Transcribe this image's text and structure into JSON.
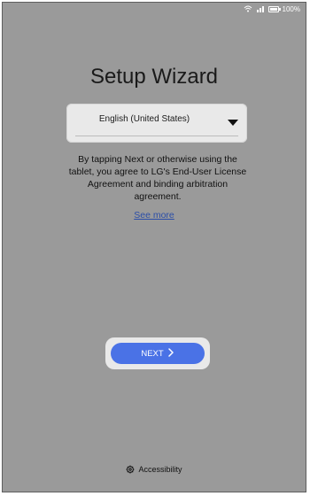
{
  "status_bar": {
    "battery_text": "100%",
    "battery_level": 1.0
  },
  "setup": {
    "title": "Setup Wizard",
    "language": {
      "selected": "English (United States)"
    },
    "agreement_text": "By tapping Next or otherwise using the tablet, you agree to LG's End-User License Agreement and binding arbitration agreement.",
    "see_more": "See more",
    "next_label": "NEXT"
  },
  "footer": {
    "accessibility_label": "Accessibility"
  },
  "icons": [
    "battery-icon",
    "wifi-icon",
    "signal-icon",
    "dropdown-caret-icon",
    "chevron-right-icon",
    "gear-icon"
  ],
  "colors": {
    "background": "#9a9a9a",
    "primary_button": "#4a72e6",
    "link": "#2b4ea8"
  }
}
